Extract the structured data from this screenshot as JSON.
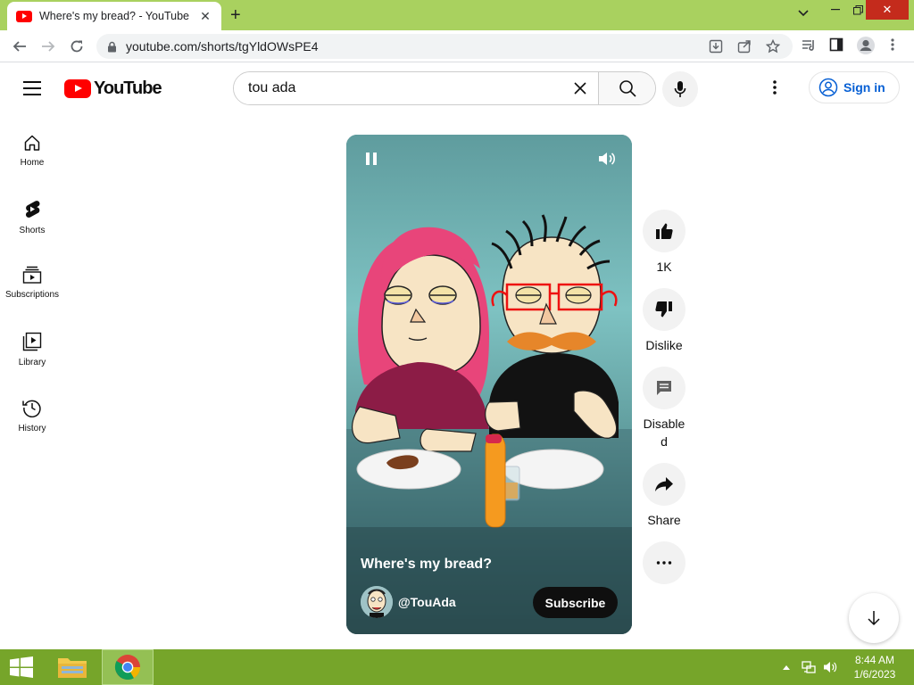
{
  "browser": {
    "tab_title": "Where's my bread? - YouTube",
    "tab_close": "✕",
    "new_tab": "+",
    "url": "youtube.com/shorts/tgYldOWsPE4",
    "window_controls": {
      "minimize": "—",
      "chevron": "⌄",
      "restore": "❐",
      "close": "✕"
    }
  },
  "youtube": {
    "logo_text": "YouTube",
    "search_value": "tou ada",
    "sign_in": "Sign in"
  },
  "sidebar": {
    "items": [
      {
        "label": "Home",
        "icon": "home-icon"
      },
      {
        "label": "Shorts",
        "icon": "shorts-icon"
      },
      {
        "label": "Subscriptions",
        "icon": "subscriptions-icon"
      },
      {
        "label": "Library",
        "icon": "library-icon"
      },
      {
        "label": "History",
        "icon": "history-icon"
      }
    ]
  },
  "video": {
    "title": "Where's my bread?",
    "channel": "@TouAda",
    "subscribe": "Subscribe"
  },
  "actions": {
    "like_count": "1K",
    "dislike": "Dislike",
    "comments": "Disabled",
    "share": "Share"
  },
  "taskbar": {
    "time": "8:44 AM",
    "date": "1/6/2023"
  },
  "colors": {
    "titlebar": "#a9d15f",
    "taskbar": "#76a52a",
    "youtube_red": "#ff0000",
    "link_blue": "#065fd4"
  }
}
